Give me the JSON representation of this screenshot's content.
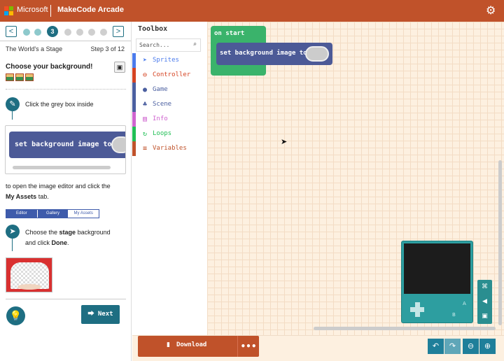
{
  "header": {
    "brand": "Microsoft",
    "app_title": "MakeCode Arcade",
    "settings_icon": "gear-icon",
    "logo_colors": [
      "#f25022",
      "#7fba00",
      "#00a4ef",
      "#ffb900"
    ]
  },
  "tutorial": {
    "prev_label": "<",
    "next_label": ">",
    "current_step": "3",
    "tutorial_name": "The World's a Stage",
    "step_counter": "Step 3 of 12",
    "heading": "Choose your background!",
    "instruction_1": "Click the grey box inside",
    "block_label": "set background image to",
    "instruction_2a": "to open the image editor and click the",
    "instruction_2b_bold": "My Assets",
    "instruction_2b_rest": " tab.",
    "editor_tabs": {
      "editor": "Editor",
      "gallery": "Gallery",
      "my_assets": "My Assets"
    },
    "instruction_3a": "Choose the ",
    "instruction_3a_bold": "stage",
    "instruction_3a_rest": " background",
    "instruction_3b": "and click ",
    "instruction_3b_bold": "Done",
    "instruction_3b_rest": ".",
    "next_button": "Next",
    "accent": "#1e6e82"
  },
  "toolbox": {
    "title": "Toolbox",
    "search_placeholder": "Search...",
    "categories": [
      {
        "label": "Sprites",
        "color": "#4b7bec",
        "icon": "paper-plane-icon"
      },
      {
        "label": "Controller",
        "color": "#d54322",
        "icon": "gamepad-icon"
      },
      {
        "label": "Game",
        "color": "#4b5fa0",
        "icon": "circle-icon"
      },
      {
        "label": "Scene",
        "color": "#4b5fa0",
        "icon": "tree-icon"
      },
      {
        "label": "Info",
        "color": "#cf63cf",
        "icon": "id-card-icon"
      },
      {
        "label": "Loops",
        "color": "#20bf55",
        "icon": "refresh-icon"
      },
      {
        "label": "Variables",
        "color": "#c0522a",
        "icon": "list-icon"
      }
    ]
  },
  "workspace": {
    "on_start_label": "on start",
    "set_bg_label": "set background image to"
  },
  "bottom": {
    "download_label": "Download",
    "more_label": "•••"
  }
}
